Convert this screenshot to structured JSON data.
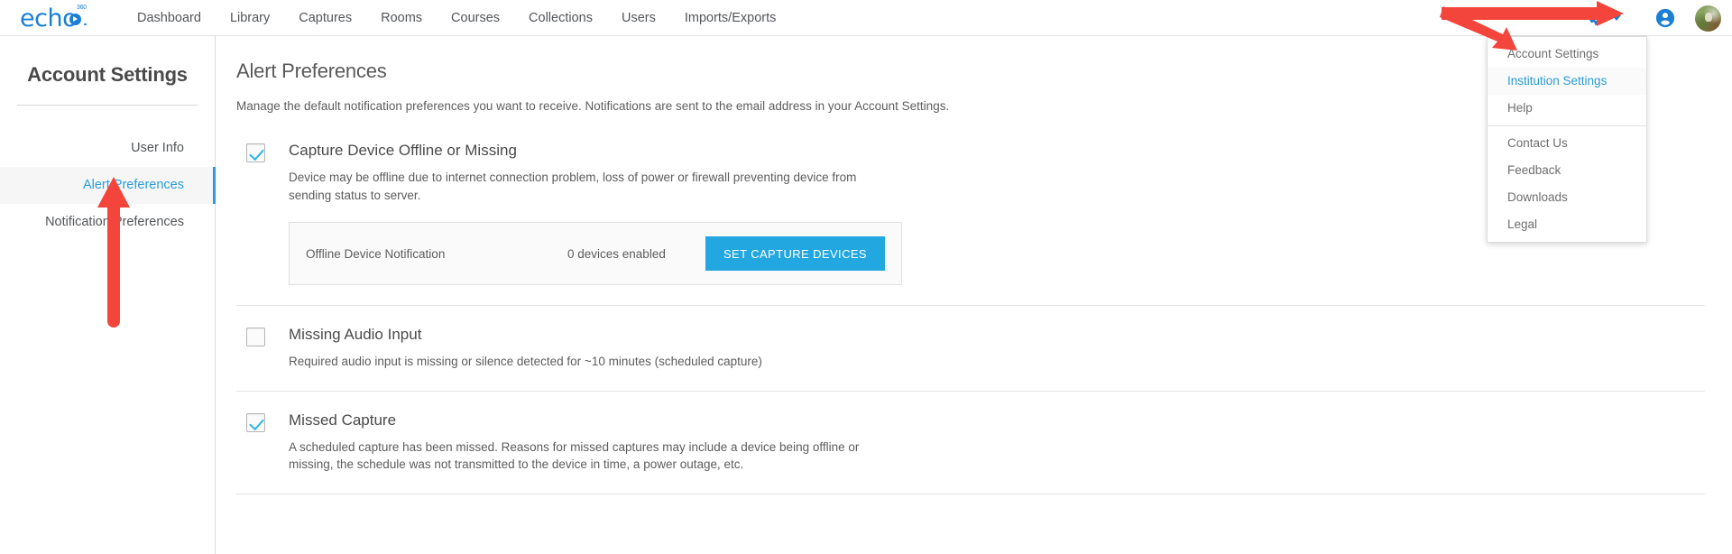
{
  "app": {
    "logo_text": "echo",
    "logo_superscript": "360"
  },
  "topnav": {
    "items": [
      {
        "label": "Dashboard",
        "name": "nav-dashboard"
      },
      {
        "label": "Library",
        "name": "nav-library"
      },
      {
        "label": "Captures",
        "name": "nav-captures"
      },
      {
        "label": "Rooms",
        "name": "nav-rooms"
      },
      {
        "label": "Courses",
        "name": "nav-courses"
      },
      {
        "label": "Collections",
        "name": "nav-collections"
      },
      {
        "label": "Users",
        "name": "nav-users"
      },
      {
        "label": "Imports/Exports",
        "name": "nav-imports-exports"
      }
    ],
    "icons": {
      "gear": "gear-icon",
      "chevron": "chevron-down-icon",
      "person": "person-icon",
      "avatar": "user-avatar"
    }
  },
  "settings_menu": {
    "items": [
      {
        "label": "Account Settings",
        "highlighted": false
      },
      {
        "label": "Institution Settings",
        "highlighted": true
      },
      {
        "label": "Help",
        "highlighted": false
      },
      {
        "label": "Contact Us",
        "highlighted": false
      },
      {
        "label": "Feedback",
        "highlighted": false
      },
      {
        "label": "Downloads",
        "highlighted": false
      },
      {
        "label": "Legal",
        "highlighted": false
      }
    ]
  },
  "sidebar": {
    "title": "Account Settings",
    "items": [
      {
        "label": "User Info",
        "active": false
      },
      {
        "label": "Alert Preferences",
        "active": true
      },
      {
        "label": "Notification Preferences",
        "active": false
      }
    ]
  },
  "main": {
    "title": "Alert Preferences",
    "subtitle": "Manage the default notification preferences you want to receive. Notifications are sent to the email address in your Account Settings.",
    "preferences": [
      {
        "title": "Capture Device Offline or Missing",
        "description": "Device may be offline due to internet connection problem, loss of power or firewall preventing device from sending status to server.",
        "checked": true,
        "device_box": {
          "label": "Offline Device Notification",
          "count": "0 devices enabled",
          "button": "SET CAPTURE DEVICES"
        }
      },
      {
        "title": "Missing Audio Input",
        "description": "Required audio input is missing or silence detected for ~10 minutes (scheduled capture)",
        "checked": false,
        "device_box": null
      },
      {
        "title": "Missed Capture",
        "description": "A scheduled capture has been missed. Reasons for missed captures may include a device being offline or missing, the schedule was not transmitted to the device in time, a power outage, etc.",
        "checked": true,
        "device_box": null
      }
    ]
  },
  "colors": {
    "brand_blue": "#1b7fd4",
    "accent_cyan": "#22a7e0",
    "link_blue": "#2b9cd8",
    "annotation_red": "#f4453c",
    "text_gray": "#5d5d5d"
  },
  "annotations": [
    {
      "name": "arrow-to-gear-and-menu",
      "color": "#f4453c",
      "shape": "double-headed-arrow"
    },
    {
      "name": "arrow-to-alert-preferences",
      "color": "#f4453c",
      "shape": "up-arrow"
    }
  ]
}
